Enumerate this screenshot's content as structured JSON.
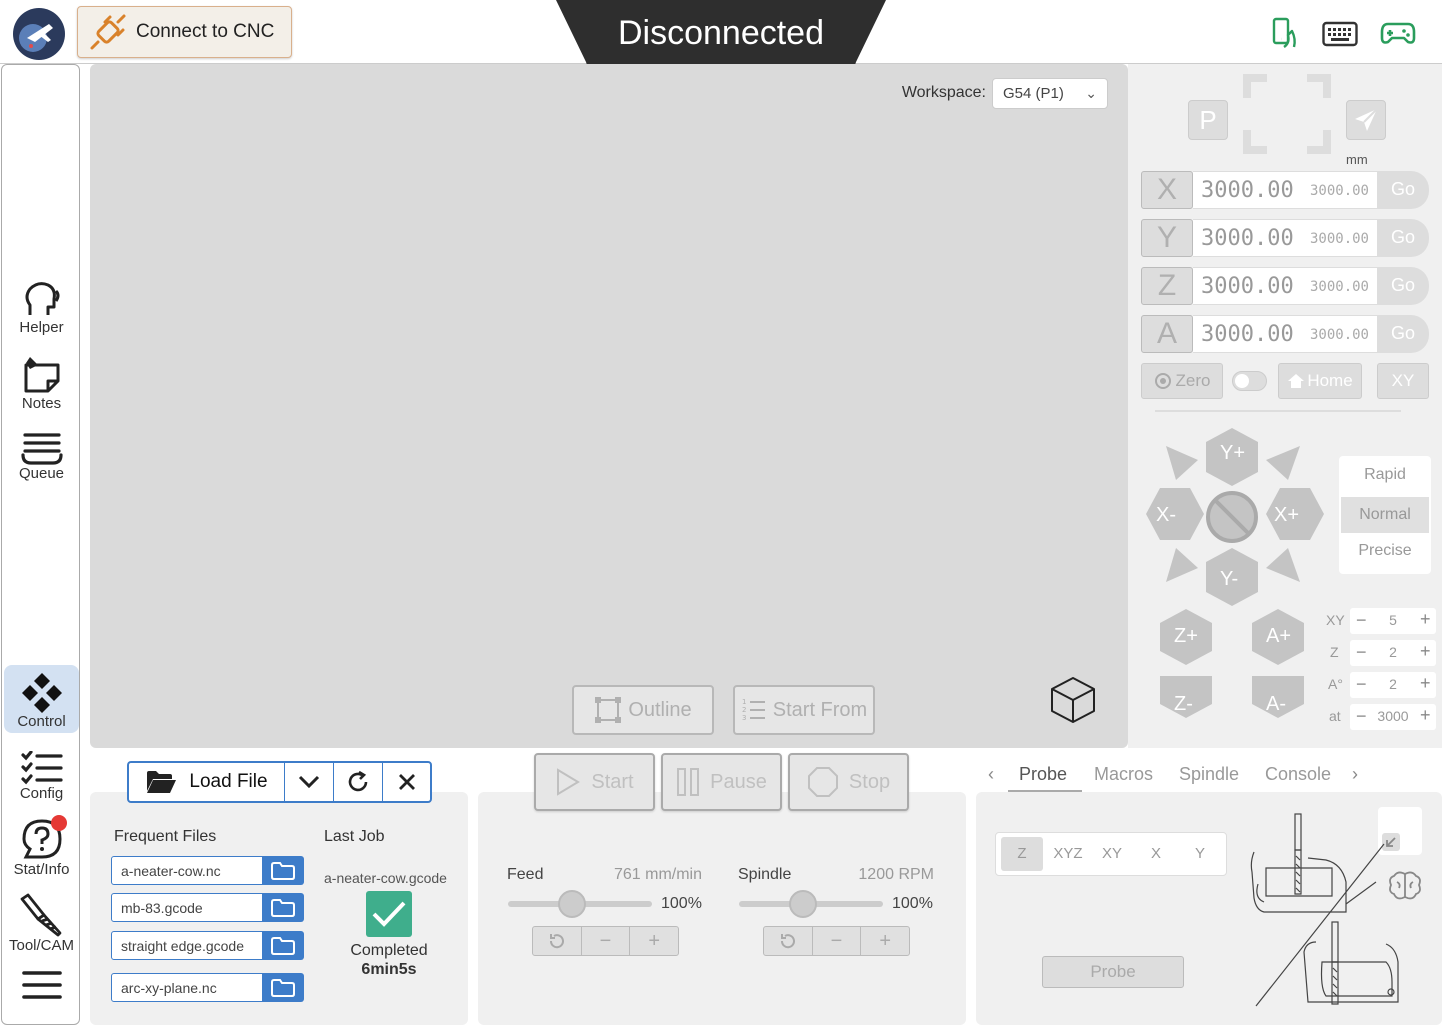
{
  "header": {
    "connect_label": "Connect to CNC",
    "status": "Disconnected",
    "icons": [
      "phone-icon",
      "keyboard-icon",
      "gamepad-icon"
    ]
  },
  "sidebar": {
    "items": [
      {
        "label": "Helper",
        "icon": "helper-head-icon"
      },
      {
        "label": "Notes",
        "icon": "sticky-note-icon"
      },
      {
        "label": "Queue",
        "icon": "queue-stack-icon"
      },
      {
        "label": "Control",
        "icon": "control-diamond-icon",
        "active": true
      },
      {
        "label": "Config",
        "icon": "checklist-icon"
      },
      {
        "label": "Stat/Info",
        "icon": "question-bubble-icon"
      },
      {
        "label": "Tool/CAM",
        "icon": "endmill-icon"
      }
    ]
  },
  "visualizer": {
    "workspace_label": "Workspace:",
    "workspace_value": "G54 (P1)",
    "outline_label": "Outline",
    "start_from_label": "Start From"
  },
  "dro": {
    "unit": "mm",
    "axes": [
      {
        "axis": "X",
        "value": "3000.00",
        "machine": "3000.00",
        "go": "Go"
      },
      {
        "axis": "Y",
        "value": "3000.00",
        "machine": "3000.00",
        "go": "Go"
      },
      {
        "axis": "Z",
        "value": "3000.00",
        "machine": "3000.00",
        "go": "Go"
      },
      {
        "axis": "A",
        "value": "3000.00",
        "machine": "3000.00",
        "go": "Go"
      }
    ],
    "zero_label": "Zero",
    "home_label": "Home",
    "xy_label": "XY",
    "p_label": "P"
  },
  "jog": {
    "y_plus": "Y+",
    "y_minus": "Y-",
    "x_plus": "X+",
    "x_minus": "X-",
    "z_plus": "Z+",
    "z_minus": "Z-",
    "a_plus": "A+",
    "a_minus": "A-",
    "speeds": [
      "Rapid",
      "Normal",
      "Precise"
    ],
    "selected_speed": "Normal",
    "increments": [
      {
        "label": "XY",
        "value": "5"
      },
      {
        "label": "Z",
        "value": "2"
      },
      {
        "label": "A°",
        "value": "2"
      },
      {
        "label": "at",
        "value": "3000"
      }
    ]
  },
  "files": {
    "load_label": "Load File",
    "frequent_title": "Frequent Files",
    "frequent": [
      "a-neater-cow.nc",
      "mb-83.gcode",
      "straight edge.gcode",
      "arc-xy-plane.nc"
    ],
    "last_job_title": "Last Job",
    "last_job_file": "a-neater-cow.gcode",
    "last_job_status": "Completed",
    "last_job_time": "6min5s"
  },
  "run": {
    "start": "Start",
    "pause": "Pause",
    "stop": "Stop",
    "feed_label": "Feed",
    "feed_value": "761 mm/min",
    "feed_pct": "100%",
    "spindle_label": "Spindle",
    "spindle_value": "1200 RPM",
    "spindle_pct": "100%"
  },
  "tools": {
    "tabs": [
      "Probe",
      "Macros",
      "Spindle",
      "Console"
    ],
    "active_tab": "Probe",
    "probe_axes": [
      "Z",
      "XYZ",
      "XY",
      "X",
      "Y"
    ],
    "probe_selected": "Z",
    "probe_button": "Probe"
  },
  "colors": {
    "accent_blue": "#3d7cc9",
    "status_banner": "#2e2e2e",
    "connect_orange": "#d9822b",
    "success_green": "#3fae8c",
    "header_icon_green": "#2a9d5c",
    "notification_red": "#e53935"
  }
}
